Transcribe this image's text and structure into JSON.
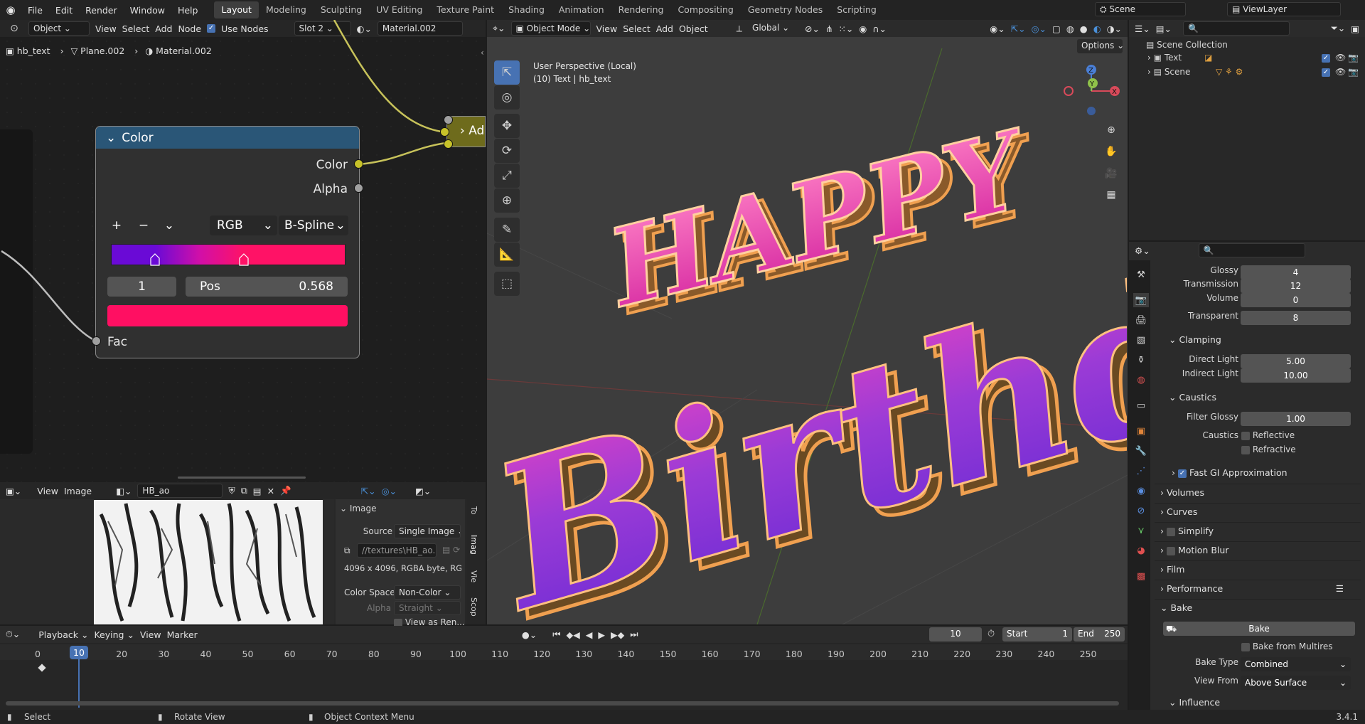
{
  "menubar": {
    "items": [
      "File",
      "Edit",
      "Render",
      "Window",
      "Help"
    ],
    "workspaces": [
      "Layout",
      "Modeling",
      "Sculpting",
      "UV Editing",
      "Texture Paint",
      "Shading",
      "Animation",
      "Rendering",
      "Compositing",
      "Geometry Nodes",
      "Scripting"
    ],
    "active_workspace": "Layout",
    "scene": "Scene",
    "view_layer": "ViewLayer"
  },
  "node_editor": {
    "object_mode": "Object",
    "menus": [
      "View",
      "Select",
      "Add",
      "Node"
    ],
    "use_nodes_label": "Use Nodes",
    "use_nodes": true,
    "slot": "Slot 2",
    "material": "Material.002",
    "breadcrumb": [
      "hb_text",
      "Plane.002",
      "Material.002"
    ],
    "node": {
      "title": "Color",
      "out_color": "Color",
      "out_alpha": "Alpha",
      "add": "+",
      "remove": "−",
      "menu": "⌄",
      "color_mode": "RGB",
      "interpolation": "B-Spline",
      "active_index": "1",
      "pos_label": "Pos",
      "pos_value": "0.568",
      "stop1_fraction": 0.188,
      "stop2_fraction": 0.568,
      "ramp_start": "#6a0ad6",
      "ramp_mid": "#d10fa8",
      "ramp_end": "#ff1266",
      "selected_color": "#ff0f62",
      "in_fac": "Fac"
    },
    "add_node_label": "Ad"
  },
  "image_editor": {
    "menus": [
      "View",
      "Image"
    ],
    "image_name": "HB_ao",
    "panel": {
      "section": "Image",
      "source_label": "Source",
      "source": "Single Image",
      "path": "//textures\\HB_ao...",
      "meta": "4096 x 4096,  RGBA byte,  RG...",
      "color_space_label": "Color Space",
      "color_space": "Non-Color",
      "alpha_label": "Alpha",
      "alpha": "Straight",
      "view_as_render": "View as Ren..."
    },
    "side_tabs": [
      "To",
      "Imag",
      "Vie",
      "Scop"
    ]
  },
  "viewport": {
    "mode": "Object Mode",
    "menus": [
      "View",
      "Select",
      "Add",
      "Object"
    ],
    "orientation": "Global",
    "options": "Options",
    "perspective": "User Perspective (Local)",
    "object_info": "(10) Text | hb_text",
    "text_line1": "HAPPY",
    "text_line2": "Birthday",
    "gizmo": {
      "x": "X",
      "y": "Y",
      "z": "Z"
    }
  },
  "outliner": {
    "root": "Scene Collection",
    "items": [
      {
        "name": "Text"
      },
      {
        "name": "Scene"
      }
    ]
  },
  "properties": {
    "rows": [
      {
        "label": "Glossy",
        "value": "4"
      },
      {
        "label": "Transmission",
        "value": "12"
      },
      {
        "label": "Volume",
        "value": "0"
      },
      {
        "label": "Transparent",
        "value": "8"
      }
    ],
    "clamping": {
      "title": "Clamping",
      "direct_label": "Direct Light",
      "direct": "5.00",
      "indirect_label": "Indirect Light",
      "indirect": "10.00"
    },
    "caustics": {
      "title": "Caustics",
      "filter_label": "Filter Glossy",
      "filter": "1.00",
      "caustics_label": "Caustics",
      "reflective": "Reflective",
      "refractive": "Refractive"
    },
    "fast_gi": "Fast GI Approximation",
    "sections": [
      "Volumes",
      "Curves",
      "Simplify",
      "Motion Blur",
      "Film",
      "Performance"
    ],
    "bake": {
      "title": "Bake",
      "button": "Bake",
      "from_multires": "Bake from Multires",
      "type_label": "Bake Type",
      "type": "Combined",
      "view_from_label": "View From",
      "view_from": "Above Surface"
    },
    "influence": "Influence"
  },
  "timeline": {
    "menus": [
      "Playback",
      "Keying",
      "View",
      "Marker"
    ],
    "current_frame": "10",
    "start_label": "Start",
    "start": "1",
    "end_label": "End",
    "end": "250",
    "ticks": [
      "0",
      "10",
      "20",
      "30",
      "40",
      "50",
      "60",
      "70",
      "80",
      "90",
      "100",
      "110",
      "120",
      "130",
      "140",
      "150",
      "160",
      "170",
      "180",
      "190",
      "200",
      "210",
      "220",
      "230",
      "240",
      "250"
    ]
  },
  "statusbar": {
    "select": "Select",
    "rotate": "Rotate View",
    "context": "Object Context Menu",
    "version": "3.4.1"
  }
}
